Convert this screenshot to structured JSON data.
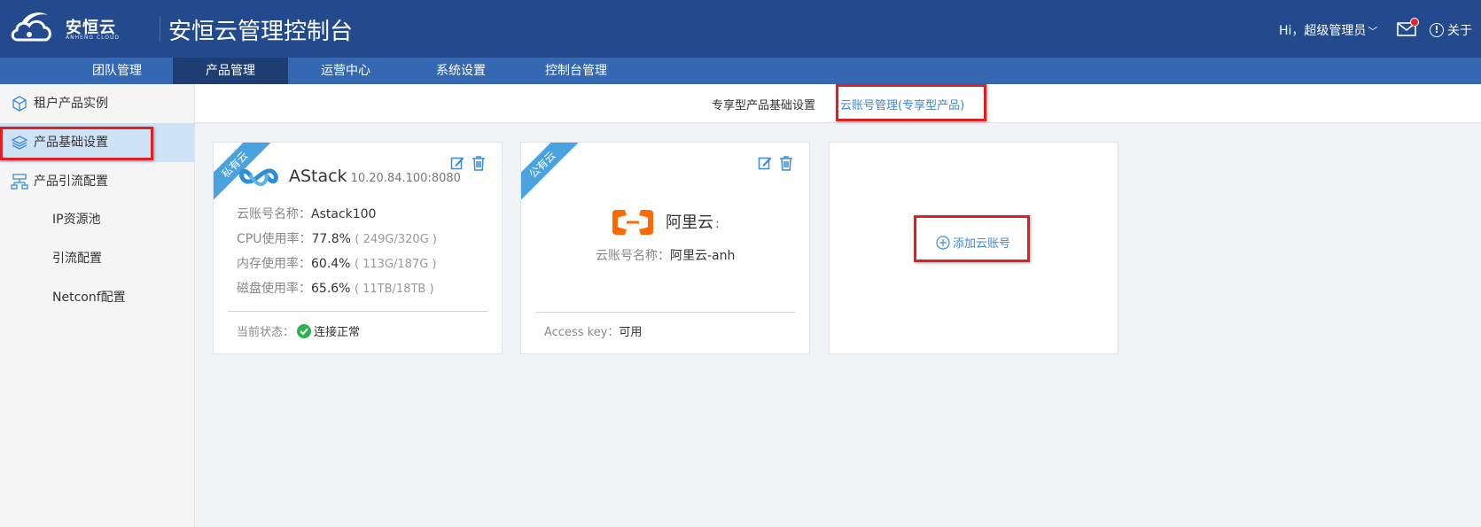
{
  "header": {
    "logo_text": "安恒云",
    "logo_sub": "ANHENG CLOUD",
    "app_title": "安恒云管理控制台",
    "user_greeting": "Hi，超级管理员",
    "about_label": "关于"
  },
  "nav": {
    "items": [
      {
        "label": "团队管理"
      },
      {
        "label": "产品管理"
      },
      {
        "label": "运营中心"
      },
      {
        "label": "系统设置"
      },
      {
        "label": "控制台管理"
      }
    ],
    "active": "产品管理"
  },
  "sidebar": {
    "items": [
      {
        "label": "租户产品实例"
      },
      {
        "label": "产品基础设置"
      },
      {
        "label": "产品引流配置"
      }
    ],
    "sub_items": [
      {
        "label": "IP资源池"
      },
      {
        "label": "引流配置"
      },
      {
        "label": "Netconf配置"
      }
    ],
    "active": "产品基础设置"
  },
  "tabs": {
    "tab1": "专享型产品基础设置",
    "tab2": "云账号管理(专享型产品)"
  },
  "cards": {
    "private": {
      "ribbon": "私有云",
      "name": "AStack",
      "ip": "10.20.84.100:8080",
      "account_label": "云账号名称：",
      "account_value": "Astack100",
      "cpu_label": "CPU使用率：",
      "cpu_value": "77.8%",
      "cpu_sub": "( 249G/320G )",
      "mem_label": "内存使用率：",
      "mem_value": "60.4%",
      "mem_sub": "( 113G/187G )",
      "disk_label": "磁盘使用率：",
      "disk_value": "65.6%",
      "disk_sub": "( 11TB/18TB )",
      "status_label": "当前状态：",
      "status_value": "连接正常"
    },
    "public": {
      "ribbon": "公有云",
      "name": "阿里云",
      "name_suffix": ":",
      "account_label": "云账号名称：",
      "account_value": "阿里云-anh",
      "access_label": "Access key：",
      "access_value": "可用"
    },
    "add_label": "添加云账号"
  },
  "colors": {
    "header_bg": "#234a8c",
    "nav_bg": "#3468b2",
    "nav_active": "#1d3d73",
    "accent": "#3b8bd6",
    "ribbon": "#4aa3e0",
    "aliyun_orange": "#ff6a00",
    "highlight_red": "#e02020",
    "ok_green": "#2bb24c"
  }
}
